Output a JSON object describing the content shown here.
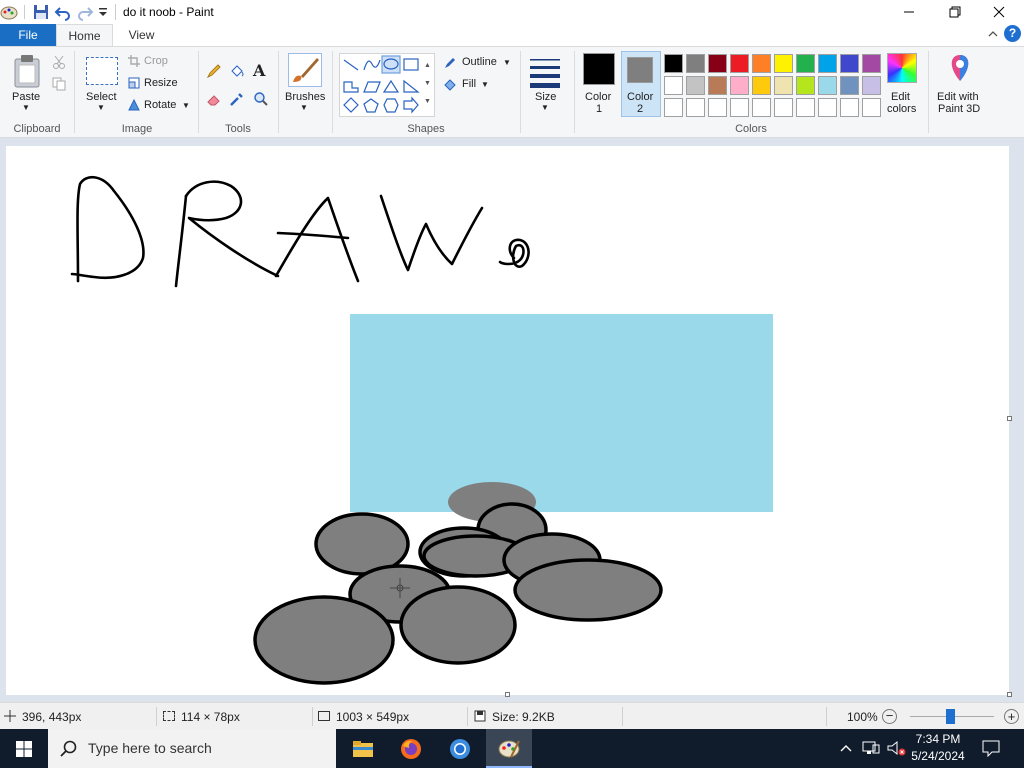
{
  "titlebar": {
    "title": "do it noob - Paint"
  },
  "tabs": {
    "file": "File",
    "home": "Home",
    "view": "View"
  },
  "ribbon": {
    "clipboard": {
      "paste": "Paste",
      "label": "Clipboard"
    },
    "image": {
      "select": "Select",
      "crop": "Crop",
      "resize": "Resize",
      "rotate": "Rotate",
      "label": "Image"
    },
    "tools": {
      "label": "Tools"
    },
    "brushes": {
      "label": "Brushes"
    },
    "shapes": {
      "outline": "Outline",
      "fill": "Fill",
      "label": "Shapes"
    },
    "size": {
      "label": "Size"
    },
    "colors": {
      "color1_label_1": "Color",
      "color1_label_2": "1",
      "color2_label_1": "Color",
      "color2_label_2": "2",
      "edit_colors_1": "Edit",
      "edit_colors_2": "colors",
      "label": "Colors",
      "color1": "#000000",
      "color2": "#7f7f7f",
      "palette_row1": [
        "#000000",
        "#7f7f7f",
        "#880015",
        "#ed1c24",
        "#ff7f27",
        "#fff200",
        "#22b14c",
        "#00a2e8",
        "#3f48cc",
        "#a349a4"
      ],
      "palette_row2": [
        "#ffffff",
        "#c3c3c3",
        "#b97a57",
        "#ffaec9",
        "#ffc90e",
        "#efe4b0",
        "#b5e61d",
        "#99d9ea",
        "#7092be",
        "#c8bfe7"
      ],
      "palette_row3": [
        "#ffffff",
        "#ffffff",
        "#ffffff",
        "#ffffff",
        "#ffffff",
        "#ffffff",
        "#ffffff",
        "#ffffff",
        "#ffffff",
        "#ffffff"
      ]
    },
    "paint3d": {
      "line1": "Edit with",
      "line2": "Paint 3D"
    }
  },
  "canvas": {
    "rect_color": "#99d9ea",
    "ellipse_fill": "#7f7f7f"
  },
  "statusbar": {
    "cursor_pos": "396, 443px",
    "selection_size": "114 × 78px",
    "canvas_size": "1003 × 549px",
    "file_size": "Size: 9.2KB",
    "zoom": "100%"
  },
  "taskbar": {
    "search_placeholder": "Type here to search",
    "time": "7:34 PM",
    "date": "5/24/2024"
  }
}
